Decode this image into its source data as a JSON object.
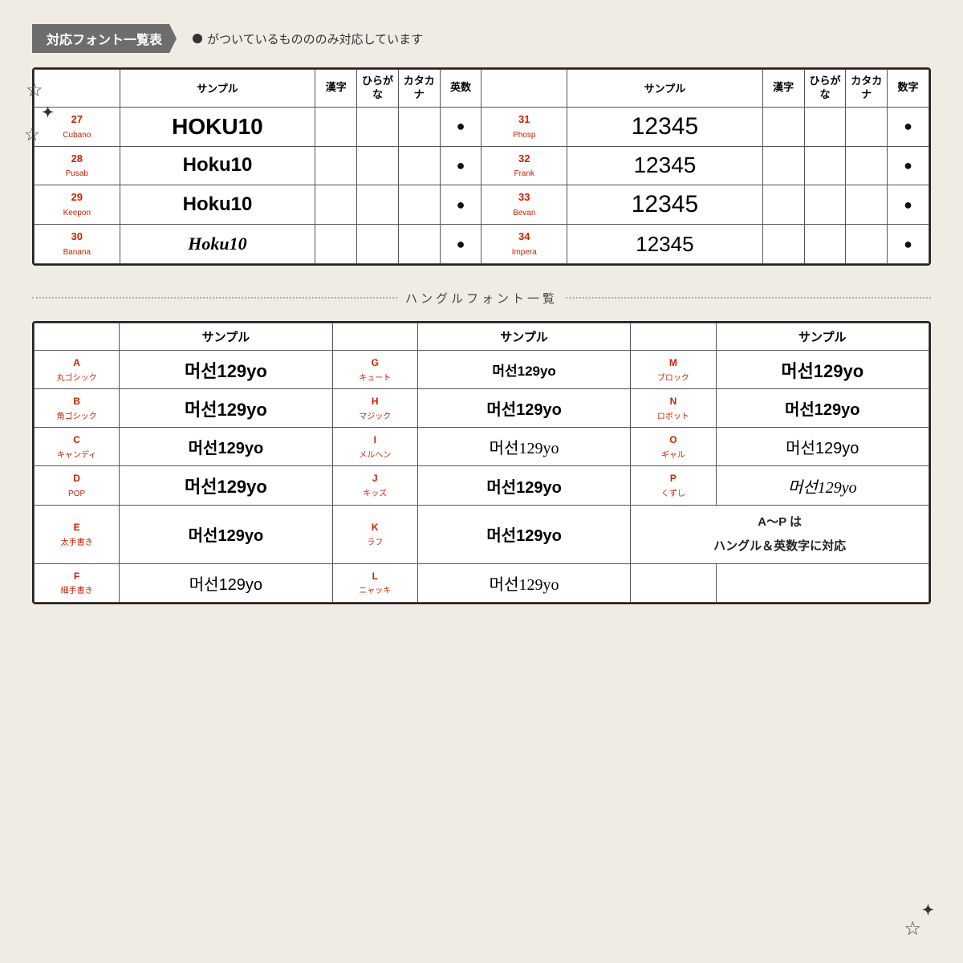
{
  "header": {
    "label": "対応フォント一覧表",
    "note": "がついているものののみ対応しています"
  },
  "topTable": {
    "columns_left": [
      "サンプル",
      "漢字",
      "ひらがな",
      "カタカナ",
      "英数"
    ],
    "columns_right": [
      "サンプル",
      "漢字",
      "ひらがな",
      "カタカナ",
      "数字"
    ],
    "rows": [
      {
        "id": "27",
        "name": "Cubano",
        "sample": "HOKU10",
        "kanji": "",
        "hira": "",
        "kata": "",
        "eisu": "●",
        "id2": "31",
        "name2": "Phosp",
        "sample2": "12345",
        "kanji2": "",
        "hira2": "",
        "kata2": "",
        "num2": "●",
        "style1": "cubano",
        "style2": "phosph"
      },
      {
        "id": "28",
        "name": "Pusab",
        "sample": "Hoku10",
        "kanji": "",
        "hira": "",
        "kata": "",
        "eisu": "●",
        "id2": "32",
        "name2": "Frank",
        "sample2": "12345",
        "kanji2": "",
        "hira2": "",
        "kata2": "",
        "num2": "●",
        "style1": "pusab",
        "style2": "frank"
      },
      {
        "id": "29",
        "name": "Keepon",
        "sample": "Hoku10",
        "kanji": "",
        "hira": "",
        "kata": "",
        "eisu": "●",
        "id2": "33",
        "name2": "Bevan",
        "sample2": "12345",
        "kanji2": "",
        "hira2": "",
        "kata2": "",
        "num2": "●",
        "style1": "keepon",
        "style2": "bevan"
      },
      {
        "id": "30",
        "name": "Banana",
        "sample": "Hoku10",
        "kanji": "",
        "hira": "",
        "kata": "",
        "eisu": "●",
        "id2": "34",
        "name2": "Impera",
        "sample2": "12345",
        "kanji2": "",
        "hira2": "",
        "kata2": "",
        "num2": "●",
        "style1": "banana",
        "style2": "impera"
      }
    ]
  },
  "divider": {
    "text": "ハングルフォント一覧"
  },
  "hangulTable": {
    "headers": [
      "",
      "サンプル",
      "",
      "サンプル",
      "",
      "サンプル"
    ],
    "rows": [
      {
        "id_a": "A",
        "label_a": "丸ゴシック",
        "sample_a": "머선129yo",
        "style_a": "maru",
        "id_g": "G",
        "label_g": "キュート",
        "sample_g": "머선129yo",
        "style_g": "cute",
        "id_m": "M",
        "label_m": "ブロック",
        "sample_m": "머선129yo",
        "style_m": "block"
      },
      {
        "id_a": "B",
        "label_a": "角ゴシック",
        "sample_a": "머선129yo",
        "style_a": "kaku",
        "id_g": "H",
        "label_g": "マジック",
        "sample_g": "머선129yo",
        "style_g": "magic",
        "id_m": "N",
        "label_m": "ロボット",
        "sample_m": "머선129yo",
        "style_m": "robot"
      },
      {
        "id_a": "C",
        "label_a": "キャンディ",
        "sample_a": "머선129yo",
        "style_a": "candy",
        "id_g": "I",
        "label_g": "メルヘン",
        "sample_g": "머선129yo",
        "style_g": "merhen",
        "id_m": "O",
        "label_m": "ギャル",
        "sample_m": "머선129yo",
        "style_m": "gyal"
      },
      {
        "id_a": "D",
        "label_a": "POP",
        "sample_a": "머선129yo",
        "style_a": "pop",
        "id_g": "J",
        "label_g": "キッズ",
        "sample_g": "머선129yo",
        "style_g": "kids",
        "id_m": "P",
        "label_m": "くずし",
        "sample_m": "머선129yo",
        "style_m": "kuzushi"
      },
      {
        "id_a": "E",
        "label_a": "太手書き",
        "sample_a": "머선129yo",
        "style_a": "futo",
        "id_g": "K",
        "label_g": "ラフ",
        "sample_g": "머선129yo",
        "style_g": "rough",
        "id_m": "note",
        "label_m": "",
        "sample_m": "A〜P は\nハングル＆英数字に対応",
        "style_m": "note"
      },
      {
        "id_a": "F",
        "label_a": "細手書き",
        "sample_a": "머선129yo",
        "style_a": "hoso",
        "id_g": "L",
        "label_g": "ニャッキ",
        "sample_g": "머선129yo",
        "style_g": "nyaki",
        "id_m": "",
        "label_m": "",
        "sample_m": "",
        "style_m": "empty"
      }
    ]
  }
}
